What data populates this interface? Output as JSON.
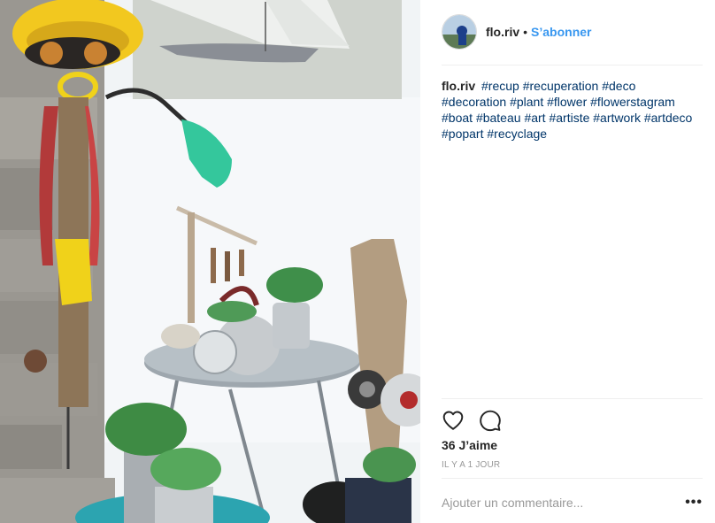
{
  "photo": {
    "alt_icon": "post-photo"
  },
  "header": {
    "username": "flo.riv",
    "separator": "•",
    "follow_label": "S’abonner"
  },
  "caption": {
    "username": "flo.riv",
    "hashtags": [
      "#recup",
      "#recuperation",
      "#deco",
      "#decoration",
      "#plant",
      "#flower",
      "#flowerstagram",
      "#boat",
      "#bateau",
      "#art",
      "#artiste",
      "#artwork",
      "#artdeco",
      "#popart",
      "#recyclage"
    ]
  },
  "actions": {
    "like_icon": "heart-icon",
    "comment_icon": "comment-bubble-icon"
  },
  "stats": {
    "likes": "36 J’aime",
    "timestamp": "IL Y A 1 JOUR"
  },
  "comment": {
    "placeholder": "Ajouter un commentaire...",
    "more_label": "•••"
  },
  "colors": {
    "link_blue": "#3897f0",
    "hashtag": "#003569",
    "muted": "#999999",
    "divider": "#efefef"
  }
}
